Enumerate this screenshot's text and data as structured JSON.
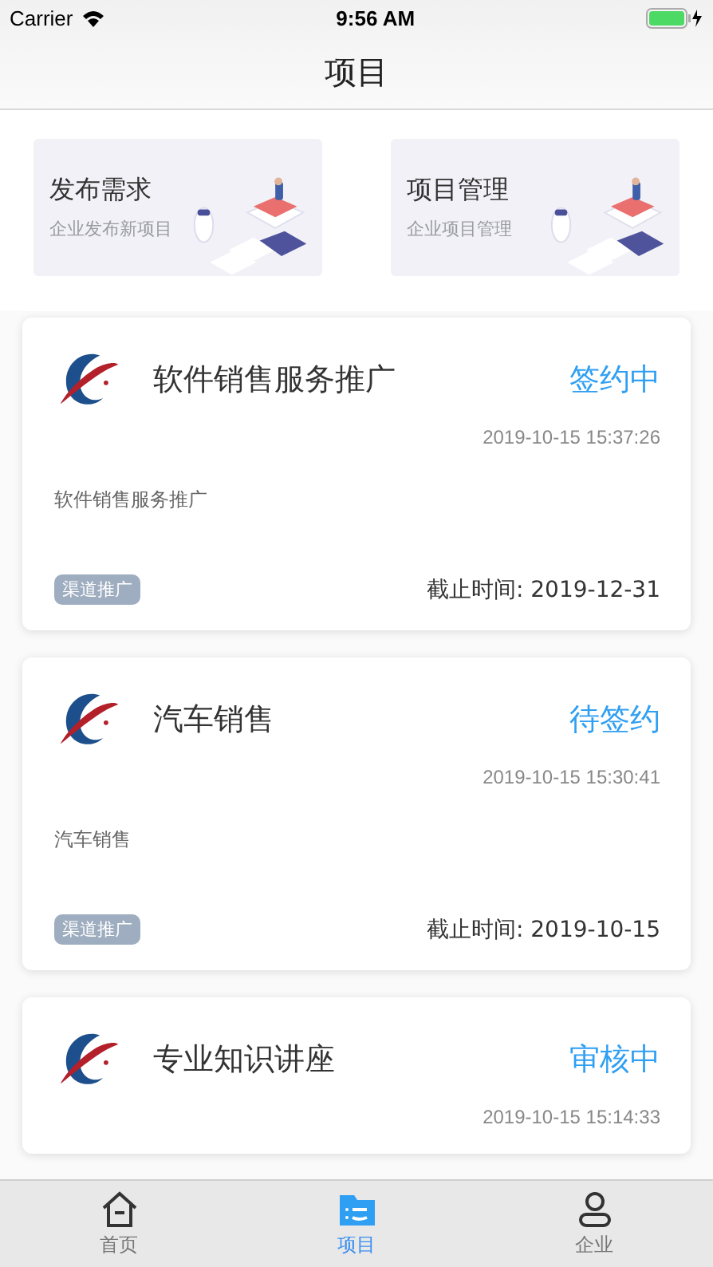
{
  "status_bar": {
    "carrier": "Carrier",
    "time": "9:56 AM"
  },
  "nav_bar": {
    "title": "项目"
  },
  "quick_actions": [
    {
      "title": "发布需求",
      "subtitle": "企业发布新项目"
    },
    {
      "title": "项目管理",
      "subtitle": "企业项目管理"
    }
  ],
  "projects": [
    {
      "title": "软件销售服务推广",
      "status": "签约中",
      "created": "2019-10-15 15:37:26",
      "description": "软件销售服务推广",
      "tag": "渠道推广",
      "deadline": "截止时间: 2019-12-31"
    },
    {
      "title": "汽车销售",
      "status": "待签约",
      "created": "2019-10-15 15:30:41",
      "description": "汽车销售",
      "tag": "渠道推广",
      "deadline": "截止时间: 2019-10-15"
    },
    {
      "title": "专业知识讲座",
      "status": "审核中",
      "created": "2019-10-15 15:14:33"
    }
  ],
  "tab_bar": [
    {
      "label": "首页",
      "kind": "home",
      "selected": false
    },
    {
      "label": "项目",
      "kind": "folder",
      "selected": true
    },
    {
      "label": "企业",
      "kind": "person",
      "selected": false
    }
  ]
}
